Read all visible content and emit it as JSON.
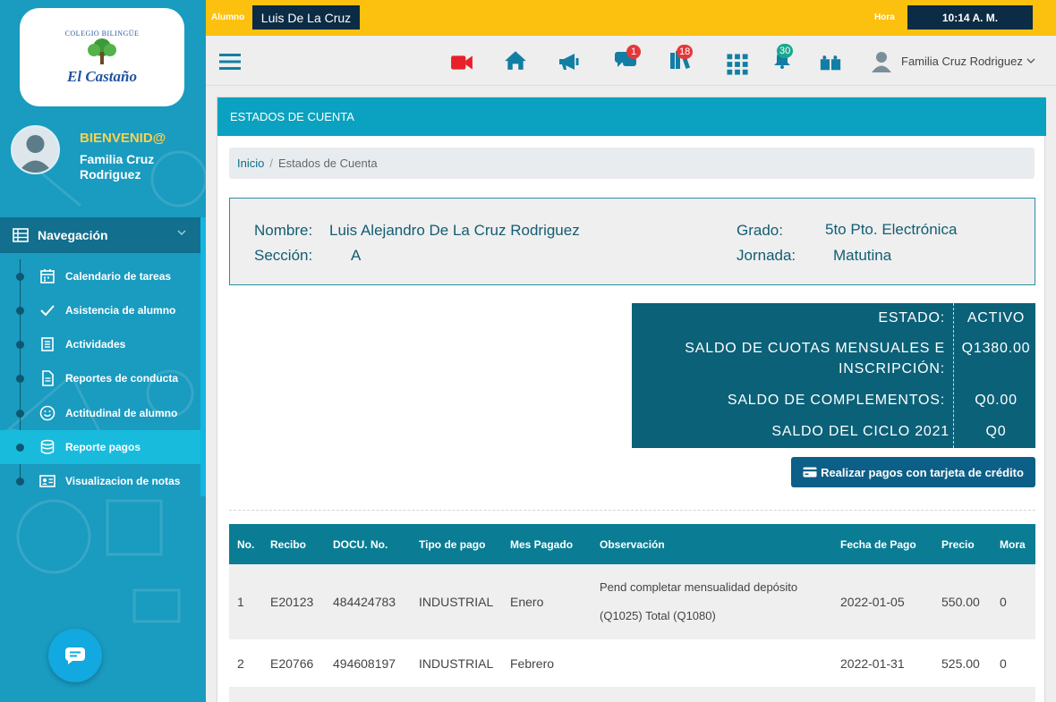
{
  "sidebar": {
    "logo": {
      "small_text": "COLEGIO BILINGÜE",
      "name": "El Castaño"
    },
    "welcome": "BIENVENID@",
    "user_name": "Familia Cruz Rodriguez",
    "nav_header": "Navegación",
    "items": [
      {
        "label": "Calendario de tareas",
        "icon": "calendar-icon"
      },
      {
        "label": "Asistencia de alumno",
        "icon": "check-icon"
      },
      {
        "label": "Actividades",
        "icon": "book-icon"
      },
      {
        "label": "Reportes de conducta",
        "icon": "document-icon"
      },
      {
        "label": "Actitudinal de alumno",
        "icon": "smile-icon"
      },
      {
        "label": "Reporte pagos",
        "icon": "database-icon",
        "active": true
      },
      {
        "label": "Visualizacion de notas",
        "icon": "id-card-icon"
      }
    ]
  },
  "topbar": {
    "student_label": "Alumno",
    "student_name": "Luis De La Cruz",
    "time_label": "Hora",
    "time": "10:14 A. M."
  },
  "toolbar": {
    "messages_badge": "1",
    "library_badge": "18",
    "notifications_badge": "30",
    "family_name": "Familia Cruz Rodriguez"
  },
  "page": {
    "title": "ESTADOS DE CUENTA",
    "breadcrumb": {
      "home": "Inicio",
      "current": "Estados de Cuenta"
    },
    "student": {
      "name_label": "Nombre:",
      "name": "Luis Alejandro De La Cruz Rodriguez",
      "section_label": "Sección:",
      "section": "A",
      "grade_label": "Grado:",
      "grade": "5to Pto. Electrónica",
      "shift_label": "Jornada:",
      "shift": "Matutina"
    },
    "status": {
      "estado_label": "ESTADO:",
      "estado": "ACTIVO",
      "cuotas_label_1": "SALDO DE CUOTAS MENSUALES E",
      "cuotas_label_2": "INSCRIPCIÓN:",
      "cuotas": "Q1380.00",
      "complementos_label": "SALDO DE COMPLEMENTOS:",
      "complementos": "Q0.00",
      "ciclo_label": "SALDO DEL CICLO 2021",
      "ciclo": "Q0"
    },
    "pay_button": "Realizar pagos con tarjeta de crédito",
    "table": {
      "headers": [
        "No.",
        "Recibo",
        "DOCU. No.",
        "Tipo de pago",
        "Mes Pagado",
        "Observación",
        "Fecha de Pago",
        "Precio",
        "Mora"
      ],
      "rows": [
        {
          "no": "1",
          "recibo": "E20123",
          "docu": "484424783",
          "tipo": "INDUSTRIAL",
          "mes": "Enero",
          "obs_1": "Pend completar mensualidad depósito",
          "obs_2": "(Q1025) Total (Q1080)",
          "fecha": "2022-01-05",
          "precio": "550.00",
          "mora": "0"
        },
        {
          "no": "2",
          "recibo": "E20766",
          "docu": "494608197",
          "tipo": "INDUSTRIAL",
          "mes": "Febrero",
          "obs_1": "",
          "obs_2": "",
          "fecha": "2022-01-31",
          "precio": "525.00",
          "mora": "0"
        }
      ]
    }
  },
  "colors": {
    "sidebar": "#1a9bc0",
    "topbar": "#fcc10e",
    "header": "#0aa2c0",
    "status_panel": "#0b6178",
    "table_header": "#0a7d94"
  }
}
